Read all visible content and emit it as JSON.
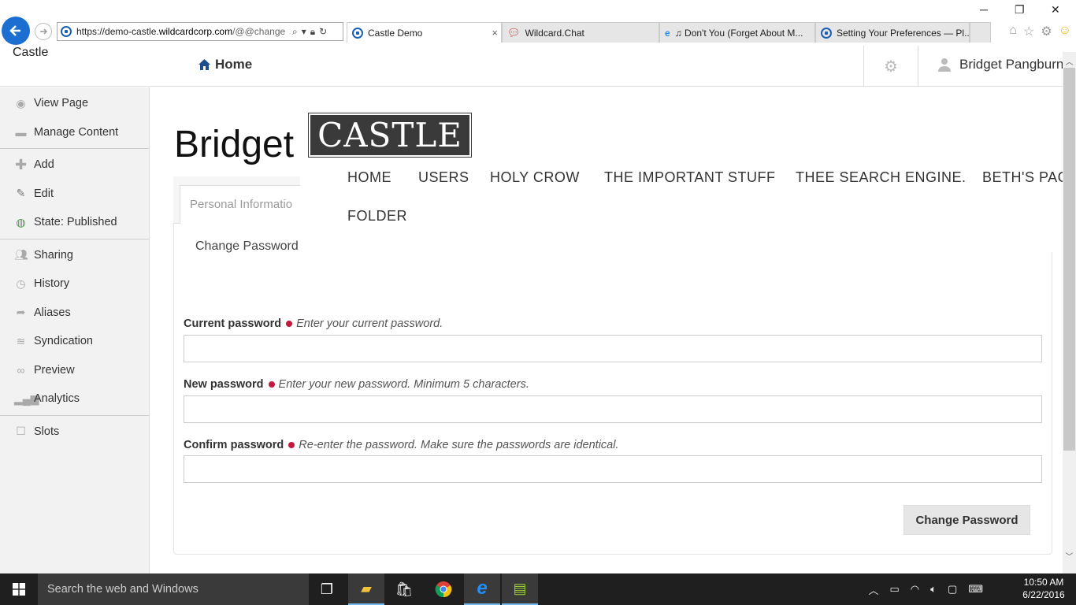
{
  "browser": {
    "url_host_prefix": "https://demo-castle.",
    "url_host_main": "wildcardcorp.com",
    "url_path": "/@@change",
    "tabs": [
      {
        "label": "Castle Demo",
        "close": "×"
      },
      {
        "label": "Wildcard.Chat"
      },
      {
        "label": "♫ Don't You (Forget About M..."
      },
      {
        "label": "Setting Your Preferences — Pl..."
      }
    ],
    "window_controls": {
      "minimize": "─",
      "restore": "❐",
      "close": "✕"
    }
  },
  "header": {
    "brand": "Castle",
    "home_label": "Home",
    "user_name": "Bridget Pangburn"
  },
  "sidebar": {
    "groups": [
      [
        {
          "label": "View Page",
          "icon": "eye-icon"
        },
        {
          "label": "Manage Content",
          "icon": "folder-icon"
        }
      ],
      [
        {
          "label": "Add",
          "icon": "plus-icon"
        },
        {
          "label": "Edit",
          "icon": "pencil-icon"
        },
        {
          "label": "State: Published",
          "icon": "globe-icon"
        }
      ],
      [
        {
          "label": "Sharing",
          "icon": "users-icon"
        },
        {
          "label": "History",
          "icon": "clock-icon"
        },
        {
          "label": "Aliases",
          "icon": "share-icon"
        },
        {
          "label": "Syndication",
          "icon": "rss-icon"
        },
        {
          "label": "Preview",
          "icon": "glasses-icon"
        },
        {
          "label": "Analytics",
          "icon": "bar-chart-icon"
        }
      ],
      [
        {
          "label": "Slots",
          "icon": "square-icon"
        }
      ]
    ]
  },
  "main": {
    "heading": "Bridget",
    "tab_personal": "Personal Informatio",
    "tab_change": "Change Password"
  },
  "site_nav": {
    "logo": "CASTLE",
    "items": [
      "HOME",
      "USERS",
      "HOLY CROW",
      "THE IMPORTANT STUFF",
      "THEE SEARCH ENGINE.",
      "BETH'S PAG",
      "FOLDER"
    ]
  },
  "form": {
    "current": {
      "label": "Current password",
      "help": "Enter your current password.",
      "value": ""
    },
    "new": {
      "label": "New password",
      "help": "Enter your new password. Minimum 5 characters.",
      "value": ""
    },
    "confirm": {
      "label": "Confirm password",
      "help": "Re-enter the password. Make sure the passwords are identical.",
      "value": ""
    },
    "submit": "Change Password"
  },
  "taskbar": {
    "search_placeholder": "Search the web and Windows",
    "time": "10:50 AM",
    "date": "6/22/2016"
  },
  "colors": {
    "accent_blue": "#1c6fd1",
    "required_dot": "#c4183c",
    "logo_bg": "#3a3a3a"
  }
}
